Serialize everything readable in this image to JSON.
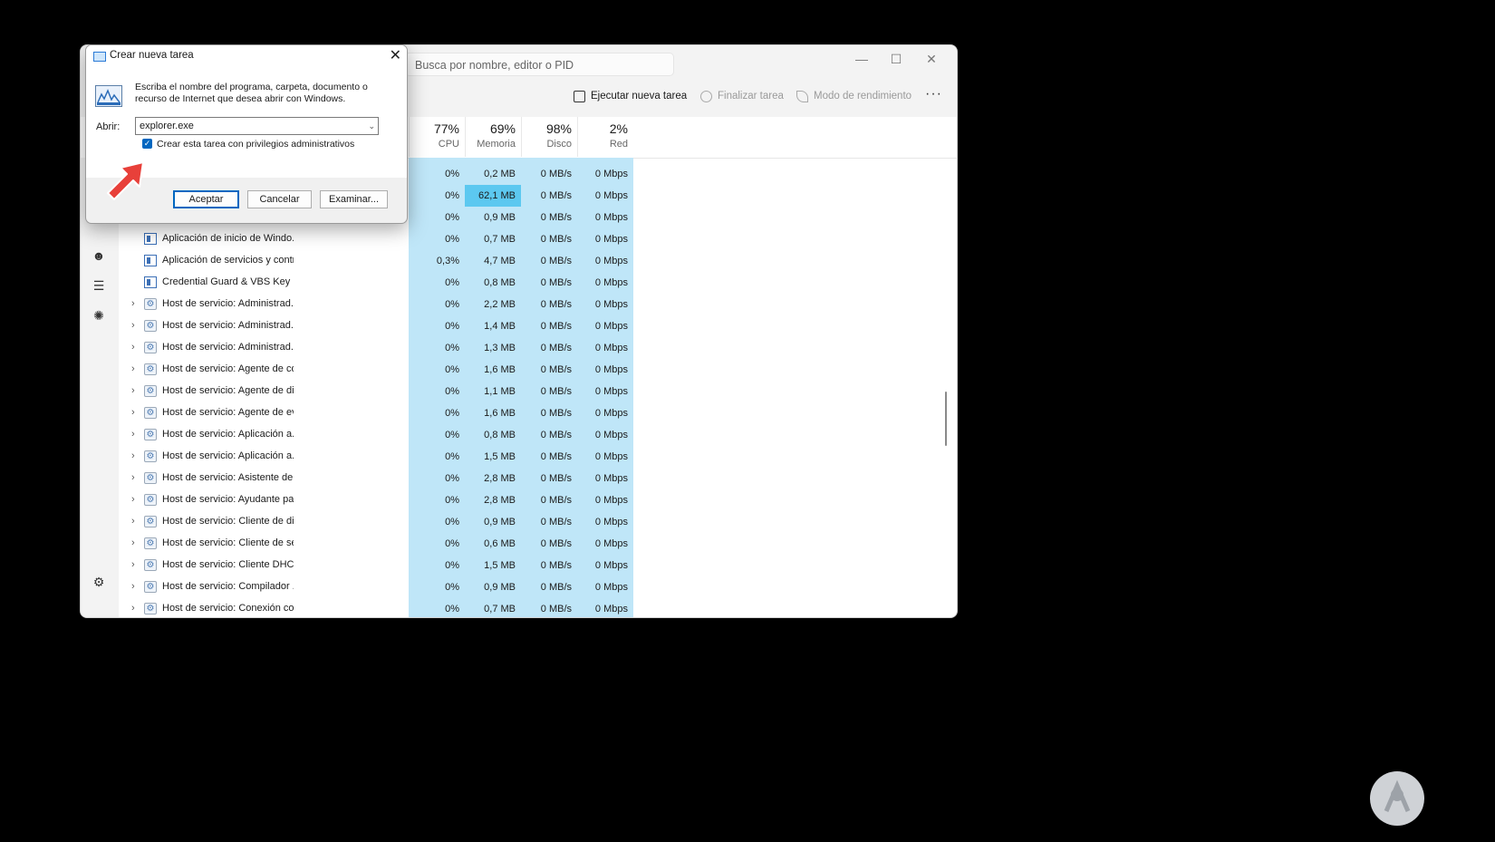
{
  "taskmanager": {
    "search_placeholder": "Busca por nombre, editor o PID",
    "toolbar": {
      "run_new_task": "Ejecutar nueva tarea",
      "end_task": "Finalizar tarea",
      "efficiency_mode": "Modo de rendimiento",
      "more": "···"
    },
    "columns": [
      {
        "pct": "77%",
        "name": "CPU"
      },
      {
        "pct": "69%",
        "name": "Memoria"
      },
      {
        "pct": "98%",
        "name": "Disco"
      },
      {
        "pct": "2%",
        "name": "Red"
      }
    ],
    "rows": [
      {
        "name": "",
        "cpu": "0%",
        "mem": "0,2 MB",
        "disk": "0 MB/s",
        "net": "0 Mbps"
      },
      {
        "name": "",
        "cpu": "0%",
        "mem": "62,1 MB",
        "disk": "0 MB/s",
        "net": "0 Mbps"
      },
      {
        "name": "",
        "cpu": "0%",
        "mem": "0,9 MB",
        "disk": "0 MB/s",
        "net": "0 Mbps"
      },
      {
        "name": "Aplicación de inicio de Windo...",
        "cpu": "0%",
        "mem": "0,7 MB",
        "disk": "0 MB/s",
        "net": "0 Mbps"
      },
      {
        "name": "Aplicación de servicios y contr...",
        "cpu": "0,3%",
        "mem": "4,7 MB",
        "disk": "0 MB/s",
        "net": "0 Mbps"
      },
      {
        "name": "Credential Guard & VBS Key Is...",
        "cpu": "0%",
        "mem": "0,8 MB",
        "disk": "0 MB/s",
        "net": "0 Mbps"
      },
      {
        "name": "Host de servicio: Administrad...",
        "cpu": "0%",
        "mem": "2,2 MB",
        "disk": "0 MB/s",
        "net": "0 Mbps"
      },
      {
        "name": "Host de servicio: Administrad...",
        "cpu": "0%",
        "mem": "1,4 MB",
        "disk": "0 MB/s",
        "net": "0 Mbps"
      },
      {
        "name": "Host de servicio: Administrad...",
        "cpu": "0%",
        "mem": "1,3 MB",
        "disk": "0 MB/s",
        "net": "0 Mbps"
      },
      {
        "name": "Host de servicio: Agente de co...",
        "cpu": "0%",
        "mem": "1,6 MB",
        "disk": "0 MB/s",
        "net": "0 Mbps"
      },
      {
        "name": "Host de servicio: Agente de di...",
        "cpu": "0%",
        "mem": "1,1 MB",
        "disk": "0 MB/s",
        "net": "0 Mbps"
      },
      {
        "name": "Host de servicio: Agente de ev...",
        "cpu": "0%",
        "mem": "1,6 MB",
        "disk": "0 MB/s",
        "net": "0 Mbps"
      },
      {
        "name": "Host de servicio: Aplicación a...",
        "cpu": "0%",
        "mem": "0,8 MB",
        "disk": "0 MB/s",
        "net": "0 Mbps"
      },
      {
        "name": "Host de servicio: Aplicación a...",
        "cpu": "0%",
        "mem": "1,5 MB",
        "disk": "0 MB/s",
        "net": "0 Mbps"
      },
      {
        "name": "Host de servicio: Asistente de ...",
        "cpu": "0%",
        "mem": "2,8 MB",
        "disk": "0 MB/s",
        "net": "0 Mbps"
      },
      {
        "name": "Host de servicio: Ayudante pa...",
        "cpu": "0%",
        "mem": "2,8 MB",
        "disk": "0 MB/s",
        "net": "0 Mbps"
      },
      {
        "name": "Host de servicio: Cliente de dir...",
        "cpu": "0%",
        "mem": "0,9 MB",
        "disk": "0 MB/s",
        "net": "0 Mbps"
      },
      {
        "name": "Host de servicio: Cliente de se...",
        "cpu": "0%",
        "mem": "0,6 MB",
        "disk": "0 MB/s",
        "net": "0 Mbps"
      },
      {
        "name": "Host de servicio: Cliente DHCP",
        "cpu": "0%",
        "mem": "1,5 MB",
        "disk": "0 MB/s",
        "net": "0 Mbps"
      },
      {
        "name": "Host de servicio: Compilador ...",
        "cpu": "0%",
        "mem": "0,9 MB",
        "disk": "0 MB/s",
        "net": "0 Mbps"
      },
      {
        "name": "Host de servicio: Conexión co...",
        "cpu": "0%",
        "mem": "0,7 MB",
        "disk": "0 MB/s",
        "net": "0 Mbps"
      }
    ]
  },
  "dialog": {
    "title": "Crear nueva tarea",
    "description": "Escriba el nombre del programa, carpeta, documento o recurso de Internet que desea abrir con Windows.",
    "open_label": "Abrir:",
    "open_value": "explorer.exe",
    "admin_checkbox_label": "Crear esta tarea con privilegios administrativos",
    "admin_checked": true,
    "ok": "Aceptar",
    "cancel": "Cancelar",
    "browse": "Examinar..."
  },
  "colors": {
    "accent": "#0067c0",
    "heat_light": "#bfe6f8",
    "heat_strong": "#5cc8f0",
    "arrow": "#e8403a"
  }
}
